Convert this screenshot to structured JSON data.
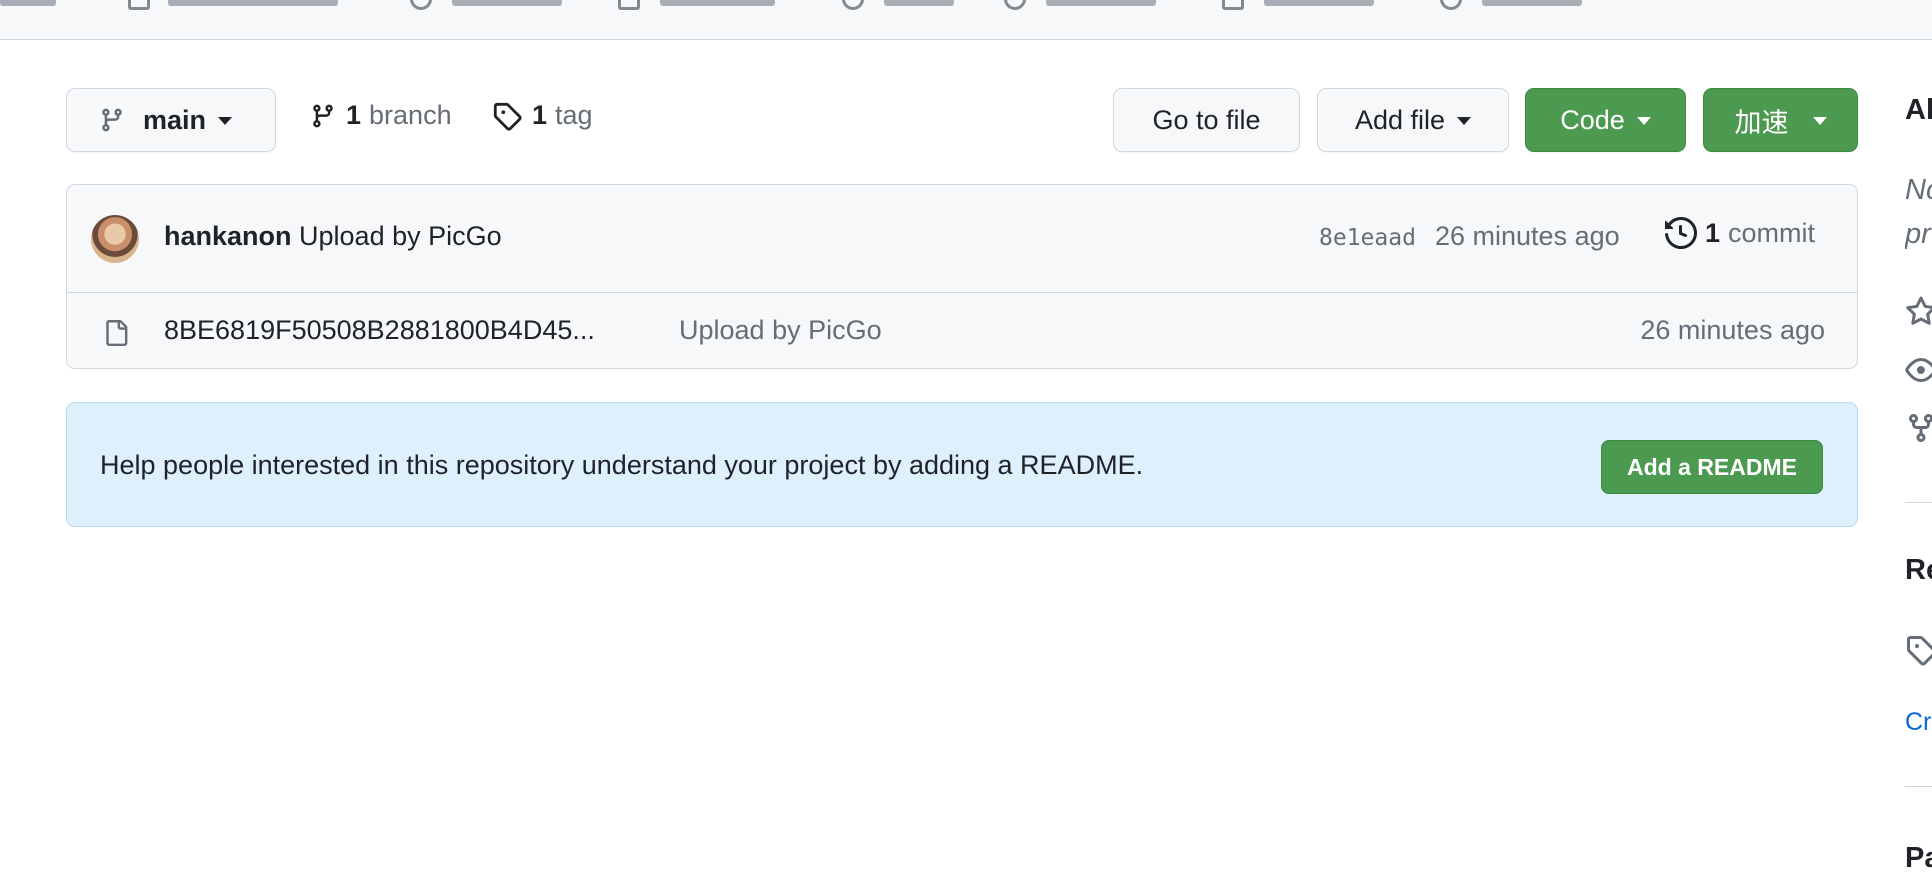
{
  "branch": {
    "current": "main",
    "branch_count": "1",
    "branch_label": "branch",
    "tag_count": "1",
    "tag_label": "tag"
  },
  "toolbar": {
    "go_to_file": "Go to file",
    "add_file": "Add file",
    "code": "Code",
    "accelerate": "加速"
  },
  "latest_commit": {
    "author": "hankanon",
    "message": "Upload by PicGo",
    "sha": "8e1eaad",
    "time": "26 minutes ago",
    "commit_count": "1",
    "commit_label": "commit"
  },
  "files": [
    {
      "name": "8BE6819F50508B2881800B4D45...",
      "message": "Upload by PicGo",
      "time": "26 minutes ago"
    }
  ],
  "readme_banner": {
    "text": "Help people interested in this repository understand your project by adding a README.",
    "button": "Add a README"
  },
  "sidebar": {
    "about_fragment": "Al",
    "desc_fragment_1": "Nc",
    "desc_fragment_2": "pr",
    "releases_fragment": "Re",
    "create_fragment": "Cr",
    "packages_fragment": "Pa"
  },
  "colors": {
    "primary_green": "#4c9a4f",
    "banner_bg": "#ddf0fb",
    "link_blue": "#0969da",
    "muted": "#656d76"
  }
}
